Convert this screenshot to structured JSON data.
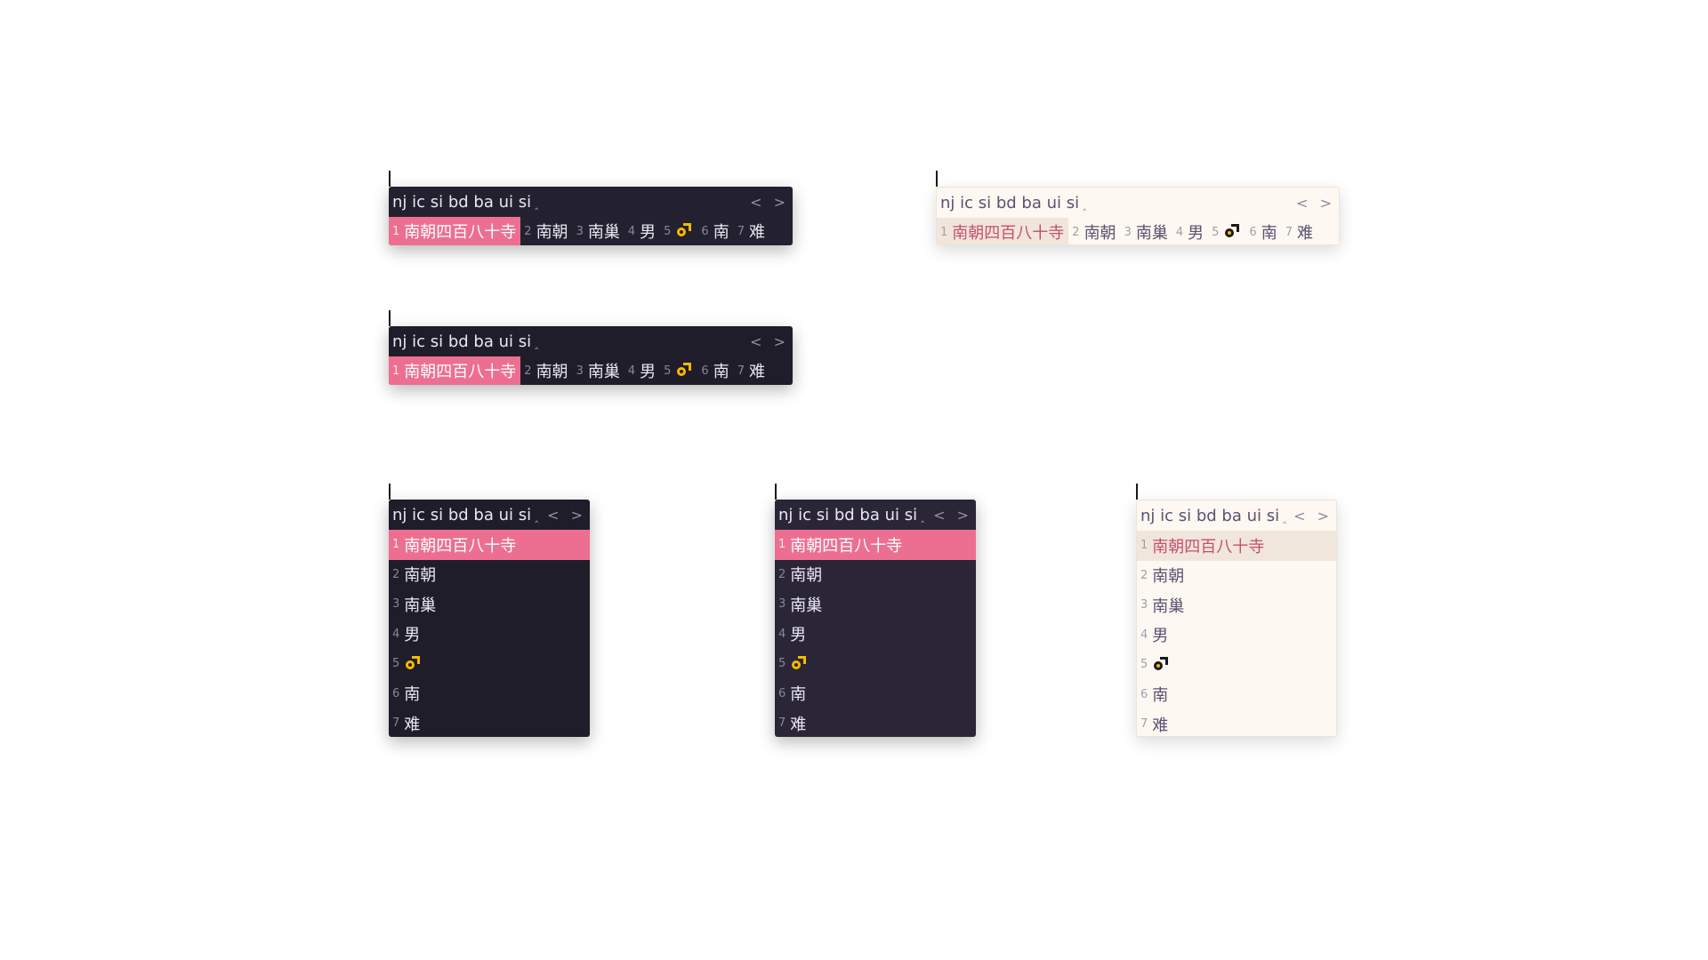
{
  "colors": {
    "highlight_dark": "#ec6f91",
    "highlight_light_bg": "#f1e6db",
    "highlight_light_text": "#c2506e",
    "emoji_yellow": "#f7b900",
    "dark_bg": "#23212f",
    "light_bg": "#fdf8f1"
  },
  "preedit": "nj ic si bd ba ui si",
  "preedit_caret": "‸",
  "pager": "< >",
  "candidates": [
    {
      "index": "1",
      "text": "南朝四百八十寺"
    },
    {
      "index": "2",
      "text": "南朝"
    },
    {
      "index": "3",
      "text": "南巢"
    },
    {
      "index": "4",
      "text": "男"
    },
    {
      "index": "5",
      "icon": "male-sign-emoji"
    },
    {
      "index": "6",
      "text": "南"
    },
    {
      "index": "7",
      "text": "难"
    }
  ]
}
